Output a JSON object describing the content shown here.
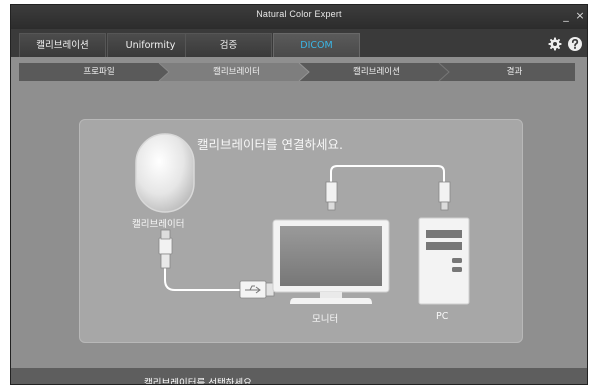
{
  "window": {
    "title": "Natural Color Expert",
    "minimize_label": "_",
    "close_label": "×"
  },
  "tabs": [
    {
      "label": "캘리브레이션",
      "active": false
    },
    {
      "label": "Uniformity",
      "active": false
    },
    {
      "label": "검증",
      "active": false
    },
    {
      "label": "DICOM",
      "active": true
    }
  ],
  "toolbar": {
    "settings_icon": "gear-icon",
    "help_icon": "help-icon"
  },
  "steps": [
    {
      "label": "프로파일",
      "current": false
    },
    {
      "label": "캘리브레이터",
      "current": true
    },
    {
      "label": "캘리브레이션",
      "current": false
    },
    {
      "label": "결과",
      "current": false
    }
  ],
  "diagram": {
    "instruction": "캘리브레이터를 연결하세요.",
    "calibrator_label": "캘리브레이터",
    "monitor_label": "모니터",
    "pc_label": "PC"
  },
  "footer": {
    "message": "캘리브레이터를 선택하세요."
  },
  "colors": {
    "accent_active_tab": "#3bb6e6",
    "window_bg": "#3a3a3a",
    "content_bg": "#8f8f8f",
    "panel_bg": "#a7a7a7"
  }
}
